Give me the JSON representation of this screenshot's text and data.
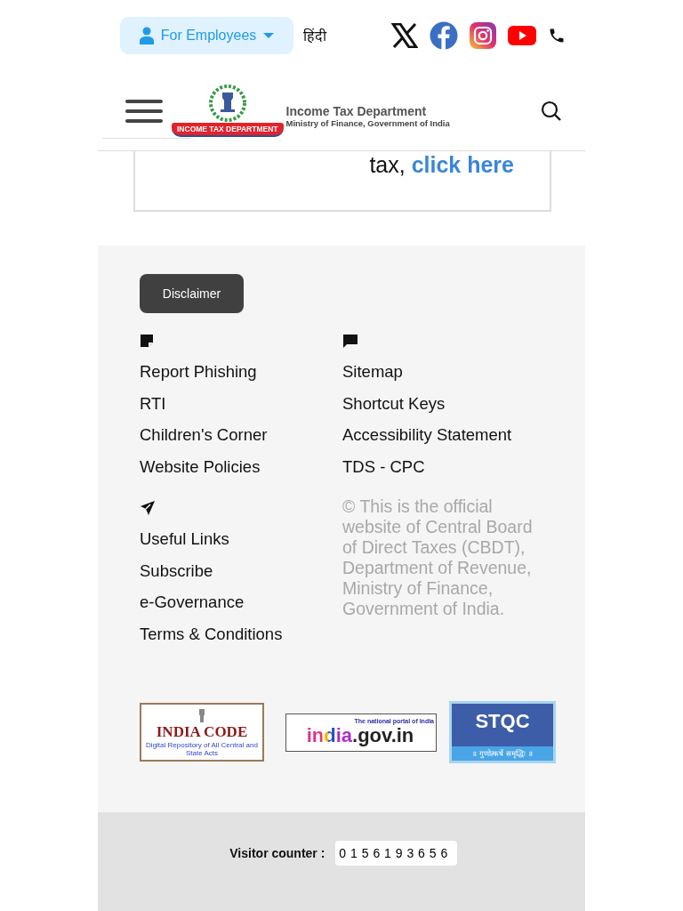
{
  "top_bar": {
    "employees_button": "For Employees",
    "language_link": "हिंदी",
    "social_links": [
      {
        "kind": "x"
      },
      {
        "kind": "facebook"
      },
      {
        "kind": "instagram"
      },
      {
        "kind": "youtube"
      },
      {
        "kind": "phone"
      }
    ]
  },
  "header": {
    "title": "Income Tax Department",
    "subtitle": "Ministry of Finance, Government of India",
    "emblem_ribbon": "INCOME TAX DEPARTMENT"
  },
  "notice": {
    "text": "tax,",
    "link": "click here"
  },
  "footer": {
    "disclaimer_button": "Disclaimer",
    "link_groups": [
      {
        "kind": "note",
        "links": [
          "Report Phishing",
          "RTI",
          "Children's Corner",
          "Website Policies"
        ]
      },
      {
        "kind": "chat",
        "links": [
          "Sitemap",
          "Shortcut Keys",
          "Accessibility Statement",
          "TDS - CPC"
        ]
      },
      {
        "kind": "send",
        "links": [
          "Useful Links",
          "Subscribe",
          "e-Governance",
          "Terms & Conditions"
        ]
      }
    ],
    "copyright": "© This is the official website of Central Board of Direct Taxes (CBDT), Department of Revenue, Ministry of Finance, Government of India.",
    "partner_logos": [
      {
        "kind": "india_code",
        "title": "INDIA CODE",
        "tagline": "Digital Repository of All Central and State Acts"
      },
      {
        "kind": "india_portal",
        "title": "india.gov.in",
        "tagline": "The national portal of India"
      },
      {
        "kind": "stqc",
        "title": "STQC",
        "tagline": "॥ गुणोत्कर्षे समृद्धिः ॥"
      }
    ]
  },
  "visitor_counter": {
    "label": "Visitor counter :",
    "value": "0 1 5 6 1 9 3 6 5 6"
  }
}
